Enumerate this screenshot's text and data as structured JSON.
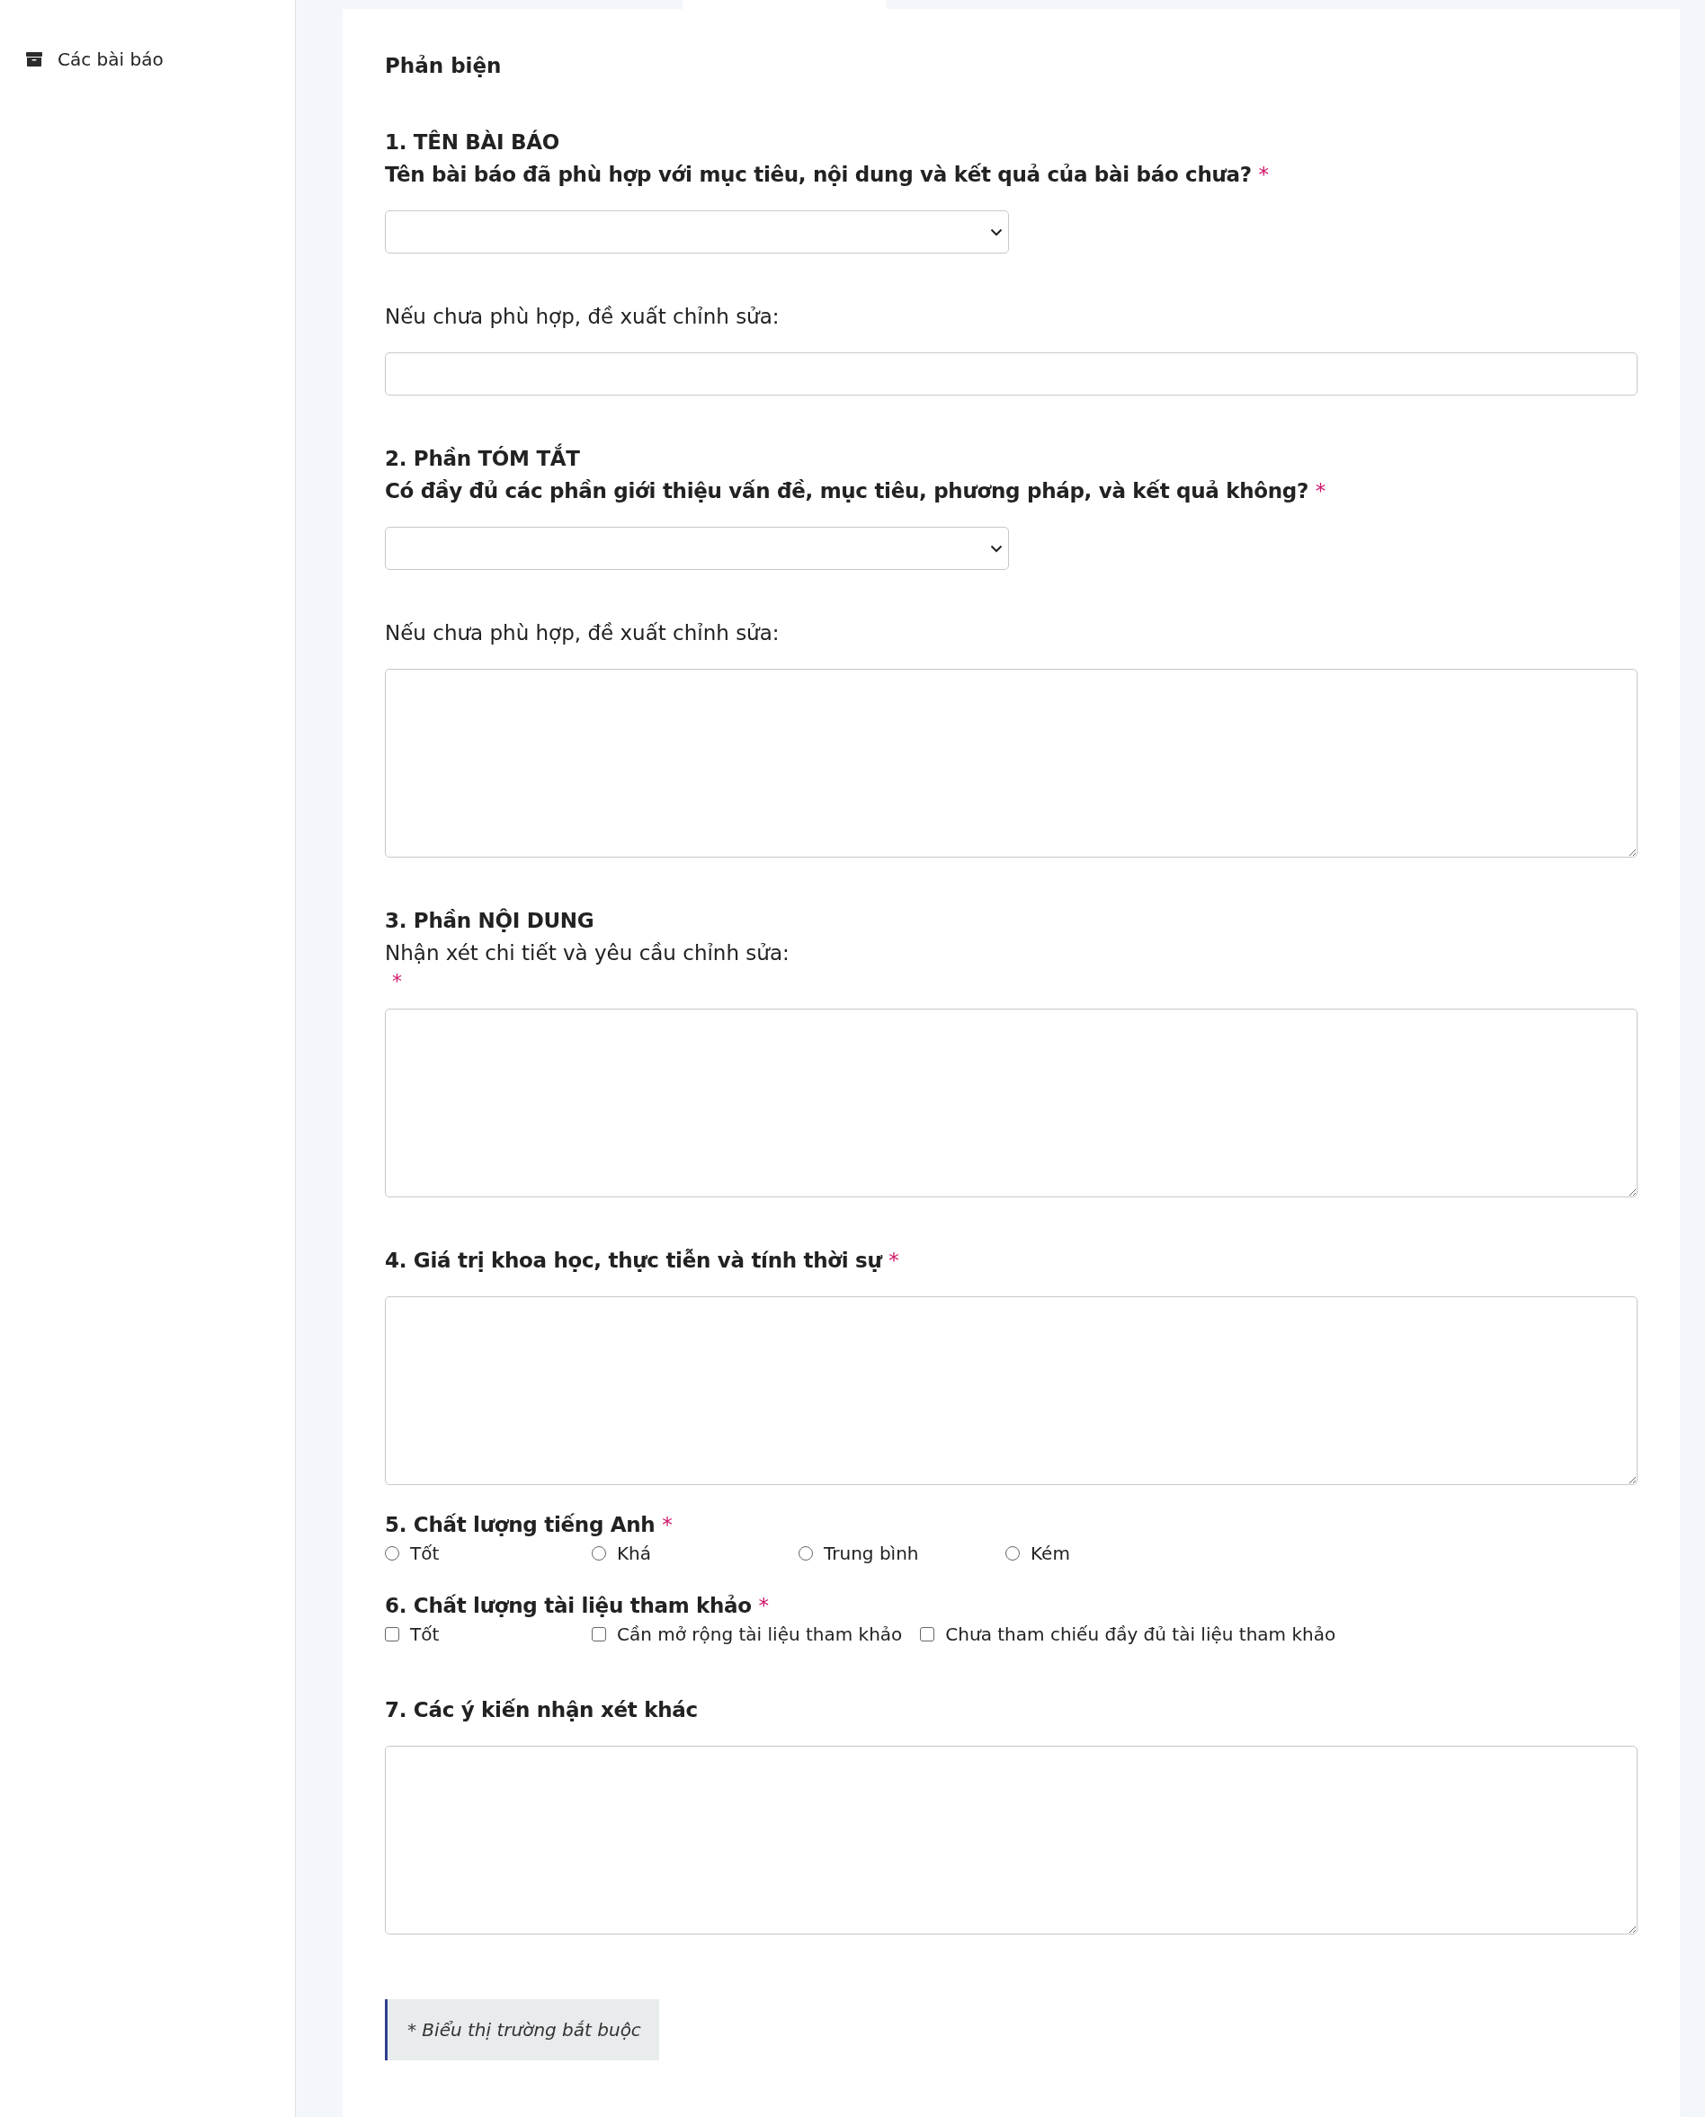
{
  "sidebar": {
    "items": [
      {
        "label": "Các bài báo",
        "selected": false
      }
    ]
  },
  "form": {
    "title": "Phản biện",
    "sections": [
      {
        "kind": "select",
        "heading": "1. TÊN BÀI BÁO",
        "question": "Tên bài báo đã phù hợp với mục tiêu, nội dung và kết quả của bài báo chưa?",
        "required_mark": "*"
      },
      {
        "kind": "input",
        "label": "Nếu chưa phù hợp, đề xuất chỉnh sửa:"
      },
      {
        "kind": "select",
        "heading": "2. Phần TÓM TẮT",
        "question": "Có đầy đủ các phần giới thiệu vấn đề, mục tiêu, phương pháp, và kết quả không?",
        "required_mark": "*"
      },
      {
        "kind": "textarea",
        "label": "Nếu chưa phù hợp, đề xuất chỉnh sửa:"
      },
      {
        "kind": "textarea",
        "heading": "3. Phần NỘI DUNG",
        "label": "Nhận xét chi tiết và yêu cầu chỉnh sửa:",
        "label_required_mark": "*"
      },
      {
        "kind": "textarea",
        "heading": "4. Giá trị khoa học, thực tiễn và tính thời sự",
        "required_mark": "*"
      },
      {
        "kind": "radio",
        "heading": "5. Chất lượng tiếng Anh",
        "required_mark": "*",
        "options": [
          {
            "label": "Tốt",
            "selected": false
          },
          {
            "label": "Khá",
            "selected": false
          },
          {
            "label": "Trung bình",
            "selected": false
          },
          {
            "label": "Kém",
            "selected": false
          }
        ]
      },
      {
        "kind": "checkbox",
        "heading": "6. Chất lượng tài liệu tham khảo",
        "required_mark": "*",
        "options": [
          {
            "label": "Tốt",
            "checked": false
          },
          {
            "label": "Cần mở rộng tài liệu tham khảo",
            "checked": false
          },
          {
            "label": "Chưa tham chiếu đầy đủ tài liệu tham khảo",
            "checked": false
          }
        ]
      },
      {
        "kind": "textarea",
        "heading": "7. Các ý kiến nhận xét khác"
      }
    ],
    "note": "* Biểu thị trường bắt buộc"
  }
}
